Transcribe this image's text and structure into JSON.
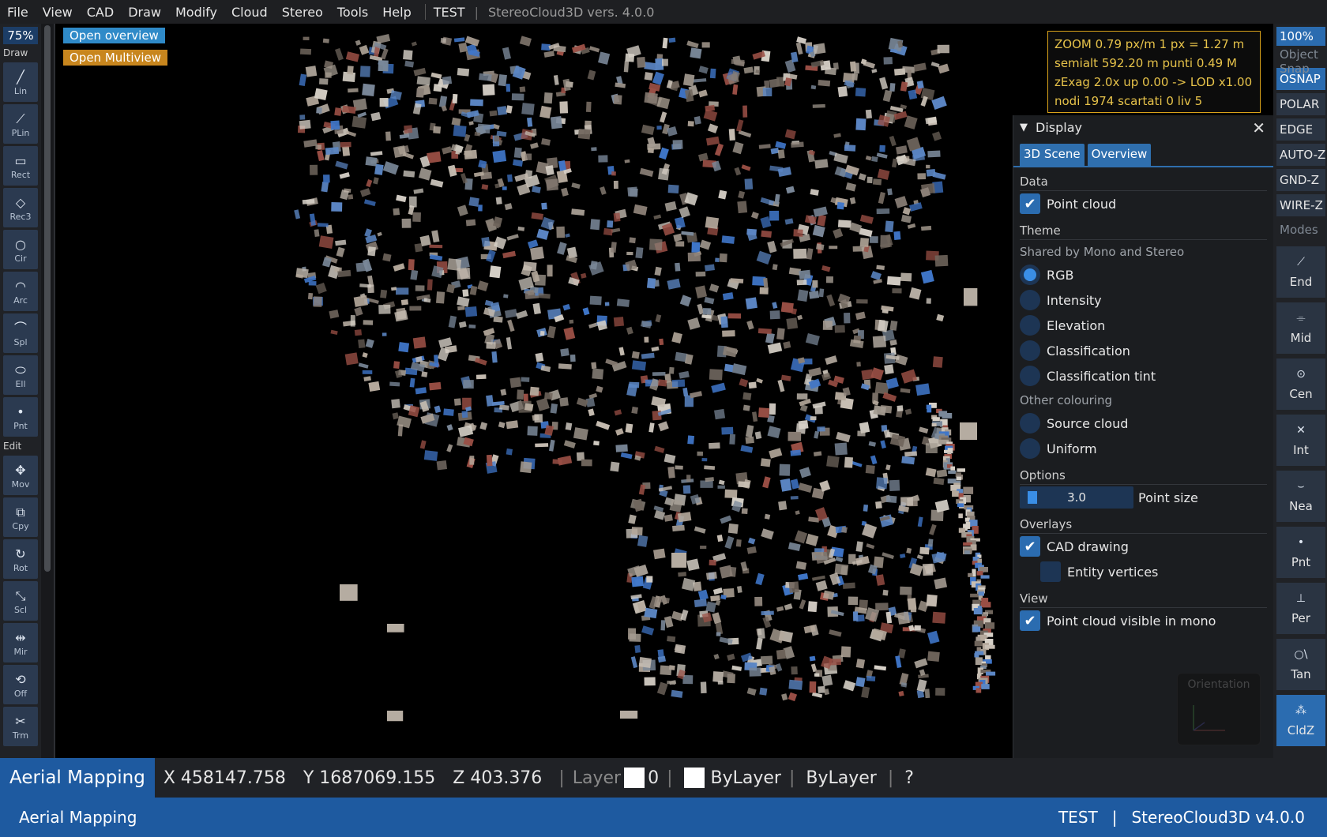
{
  "menu": {
    "items": [
      "File",
      "View",
      "CAD",
      "Draw",
      "Modify",
      "Cloud",
      "Stereo",
      "Tools",
      "Help"
    ],
    "project": "TEST",
    "separator": "|",
    "version": "StereoCloud3D vers. 4.0.0"
  },
  "left_toolbar": {
    "zoom": "75%",
    "draw_section": "Draw",
    "draw_tools": [
      {
        "label": "Lin",
        "icon": "line-icon"
      },
      {
        "label": "PLin",
        "icon": "polyline-icon"
      },
      {
        "label": "Rect",
        "icon": "rectangle-icon"
      },
      {
        "label": "Rec3",
        "icon": "rectangle3-icon"
      },
      {
        "label": "Cir",
        "icon": "circle-icon"
      },
      {
        "label": "Arc",
        "icon": "arc-icon"
      },
      {
        "label": "Spl",
        "icon": "spline-icon"
      },
      {
        "label": "Ell",
        "icon": "ellipse-icon"
      },
      {
        "label": "Pnt",
        "icon": "point-icon"
      }
    ],
    "edit_section": "Edit",
    "edit_tools": [
      {
        "label": "Mov",
        "icon": "move-icon"
      },
      {
        "label": "Cpy",
        "icon": "copy-icon"
      },
      {
        "label": "Rot",
        "icon": "rotate-icon"
      },
      {
        "label": "Scl",
        "icon": "scale-icon"
      },
      {
        "label": "Mir",
        "icon": "mirror-icon"
      },
      {
        "label": "Off",
        "icon": "offset-icon"
      },
      {
        "label": "Trm",
        "icon": "trim-icon"
      }
    ]
  },
  "viewport": {
    "open_overview": "Open overview",
    "open_multiview": "Open Multiview"
  },
  "info": {
    "line1": "ZOOM  0.79 px/m    1 px = 1.27 m",
    "line2": "semialt 592.20 m      punti 0.49 M",
    "line3": "zExag 2.0x  up 0.00  ->  LOD x1.00",
    "line4": "nodi 1974  scartati 0  liv 5"
  },
  "display_panel": {
    "title": "Display",
    "tabs": [
      "3D Scene",
      "Overview"
    ],
    "data_section": "Data",
    "point_cloud": "Point cloud",
    "theme_section": "Theme",
    "shared_label": "Shared by Mono and Stereo",
    "theme_options": [
      "RGB",
      "Intensity",
      "Elevation",
      "Classification",
      "Classification tint"
    ],
    "other_label": "Other colouring",
    "other_options": [
      "Source cloud",
      "Uniform"
    ],
    "options_section": "Options",
    "point_size_value": "3.0",
    "point_size_label": "Point size",
    "overlays_section": "Overlays",
    "cad_drawing": "CAD drawing",
    "entity_vertices": "Entity vertices",
    "view_section": "View",
    "mono_visible": "Point cloud visible in mono",
    "orientation": "Orientation"
  },
  "right_toolbar": {
    "zoom": "100%",
    "object_snap": "Object Snap",
    "toggles": [
      {
        "label": "OSNAP",
        "state": "active"
      },
      {
        "label": "POLAR",
        "state": "normal"
      },
      {
        "label": "EDGE",
        "state": "normal"
      },
      {
        "label": "AUTO-Z",
        "state": "normal"
      },
      {
        "label": "GND-Z",
        "state": "normal"
      },
      {
        "label": "WIRE-Z",
        "state": "normal"
      }
    ],
    "modes_label": "Modes",
    "snaps": [
      {
        "label": "End",
        "icon": "endpoint-icon"
      },
      {
        "label": "Mid",
        "icon": "midpoint-icon"
      },
      {
        "label": "Cen",
        "icon": "center-icon"
      },
      {
        "label": "Int",
        "icon": "intersection-icon"
      },
      {
        "label": "Nea",
        "icon": "nearest-icon"
      },
      {
        "label": "Pnt",
        "icon": "node-icon"
      },
      {
        "label": "Per",
        "icon": "perpendicular-icon"
      },
      {
        "label": "Tan",
        "icon": "tangent-icon"
      },
      {
        "label": "CldZ",
        "icon": "cloud-z-icon"
      }
    ]
  },
  "status": {
    "mode": "Aerial Mapping",
    "x": "X 458147.758",
    "y": "Y 1687069.155",
    "z": "Z 403.376",
    "layer_label": "Layer",
    "layer_value": "0",
    "color": "ByLayer",
    "linetype": "ByLayer",
    "help": "?"
  },
  "bottom": {
    "left": "Aerial Mapping",
    "project": "TEST",
    "sep": "|",
    "app": "StereoCloud3D v4.0.0"
  },
  "colors": {
    "accent": "#2b6cb0",
    "info_border": "#d9a21a",
    "multiview": "#c8861e",
    "overview": "#2f8ac8"
  }
}
